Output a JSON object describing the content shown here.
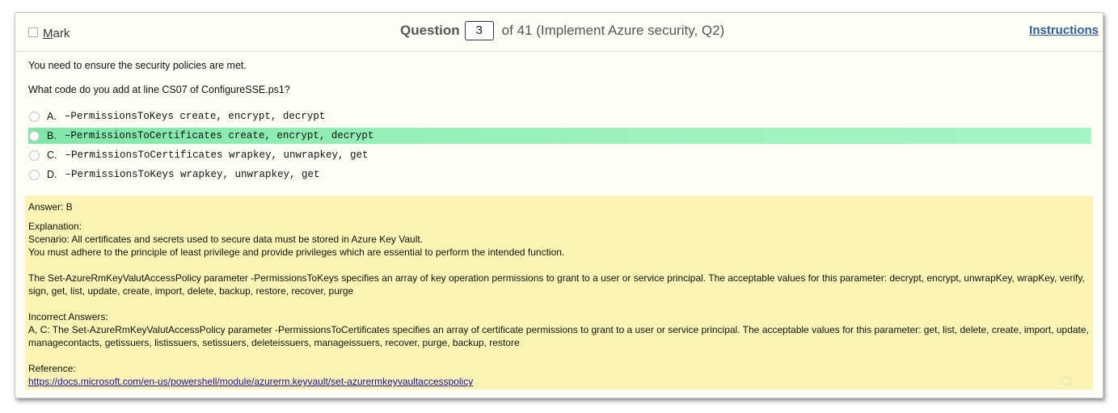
{
  "header": {
    "mark_label": "Mark",
    "question_word": "Question",
    "question_number": "3",
    "question_of": "of 41 (Implement Azure security, Q2)",
    "instructions_label": "Instructions"
  },
  "question": {
    "line1": "You need to ensure the security policies are met.",
    "line2": "What code do you add at line CS07 of ConfigureSSE.ps1?"
  },
  "options": [
    {
      "letter": "A.",
      "text": "–PermissionsToKeys create, encrypt, decrypt",
      "selected": false
    },
    {
      "letter": "B.",
      "text": "–PermissionsToCertificates create, encrypt, decrypt",
      "selected": true
    },
    {
      "letter": "C.",
      "text": "–PermissionsToCertificates wrapkey, unwrapkey, get",
      "selected": false
    },
    {
      "letter": "D.",
      "text": "–PermissionsToKeys wrapkey, unwrapkey, get",
      "selected": false
    }
  ],
  "answer": {
    "answer_line": "Answer: B",
    "explanation_title": "Explanation:",
    "scenario_line": "Scenario: All certificates and secrets used to secure data must be stored in Azure Key Vault.",
    "adhere_line": "You must adhere to the principle of least privilege and provide privileges which are essential to perform the intended function.",
    "keys_para": "The Set-AzureRmKeyValutAccessPolicy parameter -PermissionsToKeys specifies an array of key operation permissions to grant to a user or service principal. The acceptable values for this parameter: decrypt, encrypt, unwrapKey, wrapKey, verify, sign, get, list, update, create, import, delete, backup, restore, recover, purge",
    "incorrect_title": "Incorrect Answers:",
    "incorrect_para": "A, C: The Set-AzureRmKeyValutAccessPolicy parameter -PermissionsToCertificates specifies an array of certificate permissions to grant to a user or service principal. The acceptable values for this parameter: get, list, delete, create, import, update, managecontacts, getissuers, listissuers, setissuers, deleteissuers, manageissuers, recover, purge, backup, restore",
    "reference_title": "Reference:",
    "reference_link": "https://docs.microsoft.com/en-us/powershell/module/azurerm.keyvault/set-azurermkeyvaultaccesspolicy"
  },
  "icons": {
    "mark_checkbox": "checkbox-icon",
    "option_radio": "radio-icon",
    "corner": "chat-bubble-icon"
  },
  "colors": {
    "selected_option": "#95f0b6",
    "answer_background": "#faf5b4",
    "instructions_link": "#2f5f8f",
    "reference_link": "#1a0dab"
  }
}
